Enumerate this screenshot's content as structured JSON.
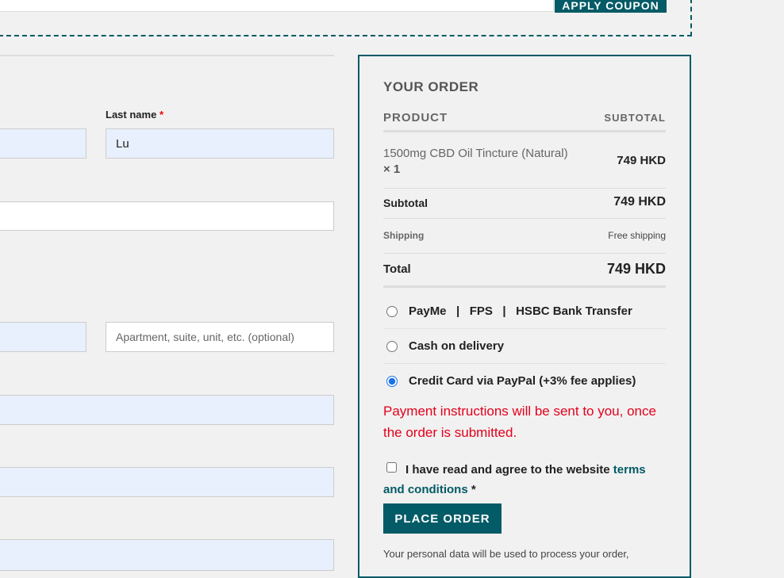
{
  "coupon": {
    "apply_label": "Apply coupon"
  },
  "billing": {
    "last_name_label": "Last name",
    "required_mark": "*",
    "first_name_value": "",
    "last_name_value": "Lu",
    "company_value": "",
    "street_value": "",
    "apartment_placeholder": "Apartment, suite, unit, etc. (optional)",
    "city_value": "",
    "postcode_value": "",
    "phone_value": ""
  },
  "order": {
    "title": "YOUR ORDER",
    "col_product": "PRODUCT",
    "col_subtotal": "SUBTOTAL",
    "items": [
      {
        "name": "1500mg CBD Oil Tincture (Natural)",
        "qty": "× 1",
        "total": "749 HKD"
      }
    ],
    "subtotal_label": "Subtotal",
    "subtotal_value": "749 HKD",
    "shipping_label": "Shipping",
    "shipping_value": "Free shipping",
    "total_label": "Total",
    "total_value": "749 HKD"
  },
  "payment": {
    "methods": [
      {
        "label": "PayMe   |   FPS   |   HSBC Bank Transfer",
        "selected": false
      },
      {
        "label": "Cash on delivery",
        "selected": false
      },
      {
        "label": "Credit Card via PayPal (+3% fee applies)",
        "selected": true
      }
    ],
    "note": "Payment instructions will be sent to you, once the order is submitted."
  },
  "terms": {
    "text": "I have read and agree to the website ",
    "link": "terms and conditions",
    "required_mark": "*",
    "checked": false
  },
  "place_order_label": "Place order",
  "privacy_text": "Your personal data will be used to process your order,",
  "colors": {
    "accent": "#025b66",
    "error": "#e3001b",
    "autofill": "#e8f0fe"
  }
}
